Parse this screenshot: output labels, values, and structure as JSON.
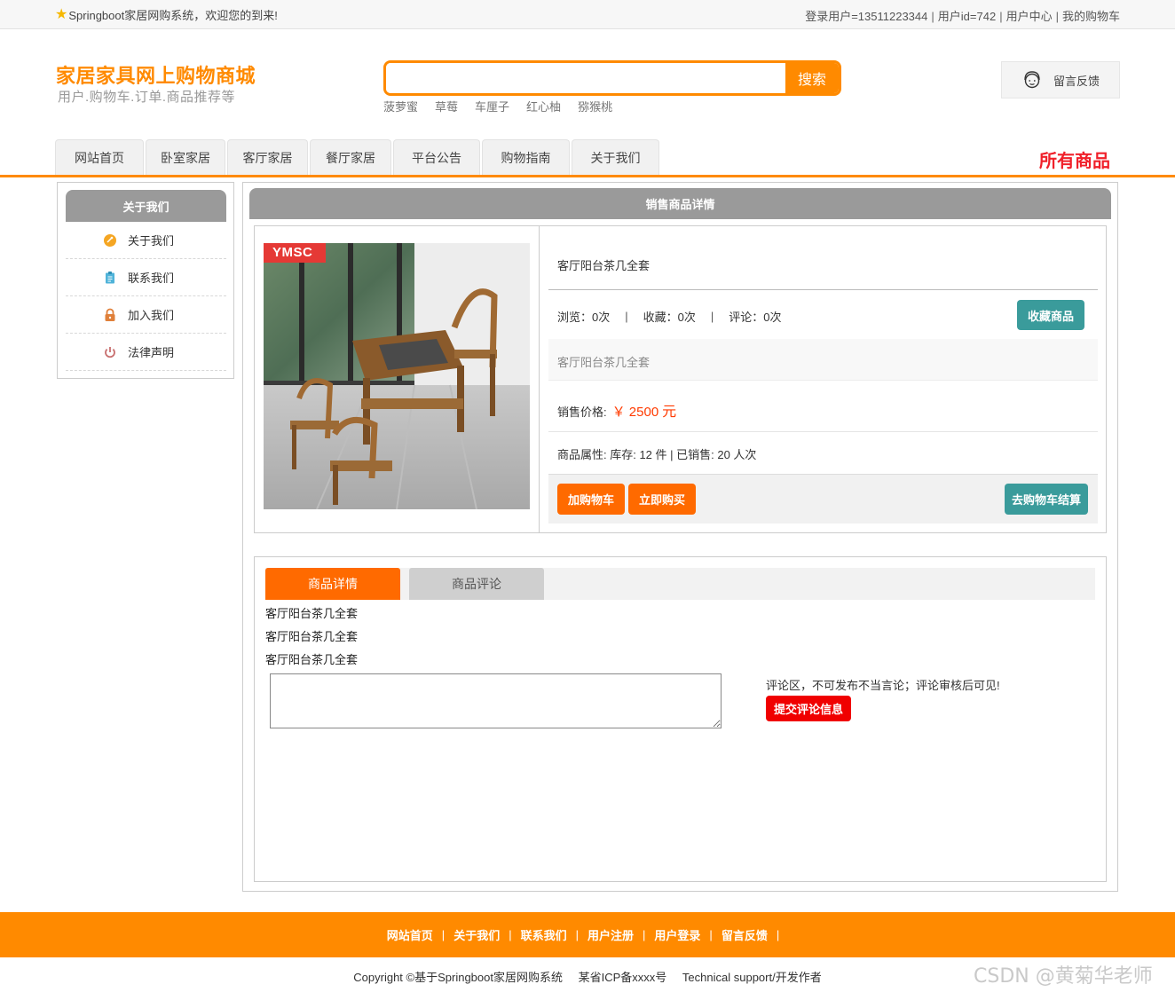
{
  "topbar": {
    "welcome": "Springboot家居网购系统，欢迎您的到来!",
    "login_user": "登录用户=13511223344",
    "user_id": "用户id=742",
    "user_center": "用户中心",
    "my_cart": "我的购物车",
    "separator": "|"
  },
  "header": {
    "title": "家居家具网上购物商城",
    "subtitle": "用户.购物车.订单.商品推荐等",
    "search_placeholder": "",
    "search_button": "搜索",
    "hot_words": [
      "菠萝蜜",
      "草莓",
      "车厘子",
      "红心柚",
      "猕猴桃"
    ],
    "feedback": "留言反馈"
  },
  "nav": {
    "tabs": [
      "网站首页",
      "卧室家居",
      "客厅家居",
      "餐厅家居",
      "平台公告",
      "购物指南",
      "关于我们"
    ],
    "all_goods": "所有商品"
  },
  "sidebar": {
    "title": "关于我们",
    "items": [
      {
        "label": "关于我们",
        "icon": "orange-circle-icon",
        "color": "#f5a623"
      },
      {
        "label": "联系我们",
        "icon": "clipboard-icon",
        "color": "#4fb3d9"
      },
      {
        "label": "加入我们",
        "icon": "lock-icon",
        "color": "#e0803a"
      },
      {
        "label": "法律声明",
        "icon": "power-icon",
        "color": "#c86f6f"
      }
    ]
  },
  "product": {
    "section_title": "销售商品详情",
    "image_badge": "YMSC",
    "name": "客厅阳台茶几全套",
    "views": "浏览：0次",
    "favorites": "收藏：0次",
    "comments": "评论：0次",
    "stat_separator": "|",
    "favorite_button": "收藏商品",
    "description": "客厅阳台茶几全套",
    "price_label": "销售价格:",
    "price": "￥ 2500",
    "price_unit": "元",
    "attributes": "商品属性:   库存: 12 件 | 已销售: 20 人次",
    "add_cart_button": "加购物车",
    "buy_now_button": "立即购买",
    "checkout_button": "去购物车结算"
  },
  "tabs": {
    "detail_tab": "商品详情",
    "review_tab": "商品评论",
    "detail_lines": [
      "客厅阳台茶几全套",
      "客厅阳台茶几全套",
      "客厅阳台茶几全套"
    ],
    "comment_placeholder": "",
    "comment_note": "评论区，不可发布不当言论；评论审核后可见!",
    "submit_button": "提交评论信息"
  },
  "footer": {
    "links": [
      "网站首页",
      "关于我们",
      "联系我们",
      "用户注册",
      "用户登录",
      "留言反馈"
    ],
    "separator": "|",
    "copyright": "Copyright ©基于Springboot家居网购系统",
    "icp": "某省ICP备xxxx号",
    "support": "Technical support/开发作者"
  },
  "watermark": "CSDN @黄菊华老师",
  "colors": {
    "accent": "#ff8a00",
    "button_orange": "#ff6a00",
    "button_teal": "#3a9b9b",
    "price_red": "#ff3a00",
    "all_goods_red": "#f0202a"
  }
}
